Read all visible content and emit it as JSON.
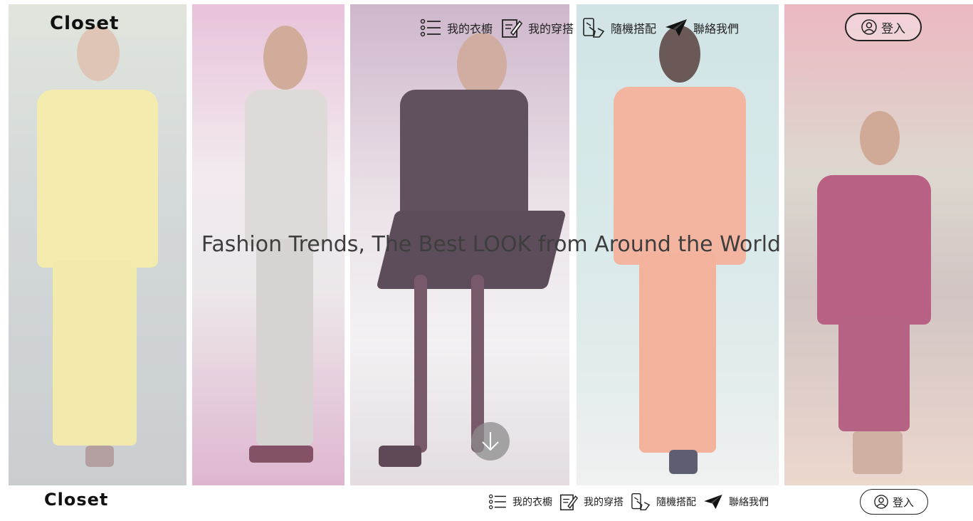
{
  "brand": {
    "logo_text": "Closet"
  },
  "nav": {
    "items": [
      {
        "label": "我的衣櫥",
        "icon": "list-icon"
      },
      {
        "label": "我的穿搭",
        "icon": "edit-icon"
      },
      {
        "label": "隨機搭配",
        "icon": "touch-icon"
      },
      {
        "label": "聯絡我們",
        "icon": "paper-plane-icon"
      }
    ],
    "login_label": "登入",
    "login_icon": "user-circle-icon"
  },
  "hero": {
    "title": "Fashion Trends, The Best LOOK from Around the World",
    "scroll_icon": "arrow-down-icon",
    "panels": [
      {
        "name": "yellow-suit-look",
        "outfit_color": "#f1e89d"
      },
      {
        "name": "grey-blazer-look",
        "outfit_color": "#d6d2d0"
      },
      {
        "name": "black-suit-look",
        "outfit_color": "#3f2a3a"
      },
      {
        "name": "coral-suit-look",
        "outfit_color": "#f2a58b"
      },
      {
        "name": "street-style-look",
        "outfit_color": "#a93f6a"
      }
    ]
  },
  "footer": {
    "logo_text": "Closet",
    "nav_items": [
      {
        "label": "我的衣櫥",
        "icon": "list-icon"
      },
      {
        "label": "我的穿搭",
        "icon": "edit-icon"
      },
      {
        "label": "隨機搭配",
        "icon": "touch-icon"
      },
      {
        "label": "聯絡我們",
        "icon": "paper-plane-icon"
      }
    ],
    "login_label": "登入"
  },
  "colors": {
    "text_dark": "#222222",
    "title_text": "#3e3e3e",
    "scroll_button": "#8c8c8c"
  }
}
